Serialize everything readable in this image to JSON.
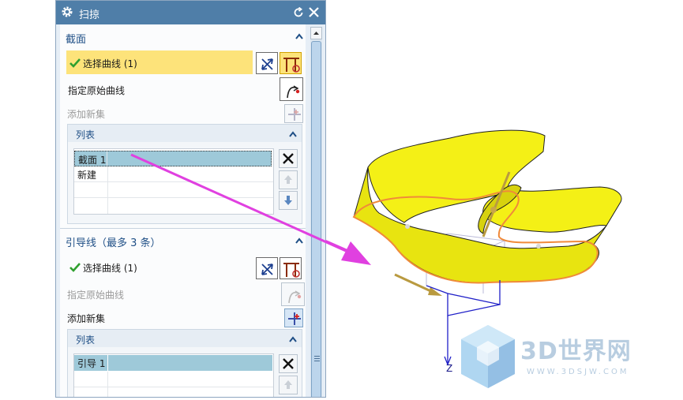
{
  "dialog": {
    "title": "扫掠",
    "section_profile": {
      "title": "截面",
      "select_curve": "选择曲线 (1)",
      "specify_origin": "指定原始曲线",
      "add_new_set": "添加新集",
      "list": {
        "title": "列表",
        "rows": [
          "截面 1",
          "新建"
        ]
      }
    },
    "section_guide": {
      "title": "引导线（最多 3 条）",
      "select_curve": "选择曲线 (1)",
      "specify_origin": "指定原始曲线",
      "add_new_set": "添加新集",
      "list": {
        "title": "列表",
        "rows": [
          "引导 1"
        ]
      }
    }
  },
  "viewport": {
    "axis_label": "Z",
    "watermark_title": "3D世界网",
    "watermark_url": "WWW.3DSJW.COM"
  },
  "colors": {
    "title_bar": "#4f7ea8",
    "highlight": "#fde37a",
    "surface": "#f2ee1a",
    "arrow": "#e040e0"
  }
}
